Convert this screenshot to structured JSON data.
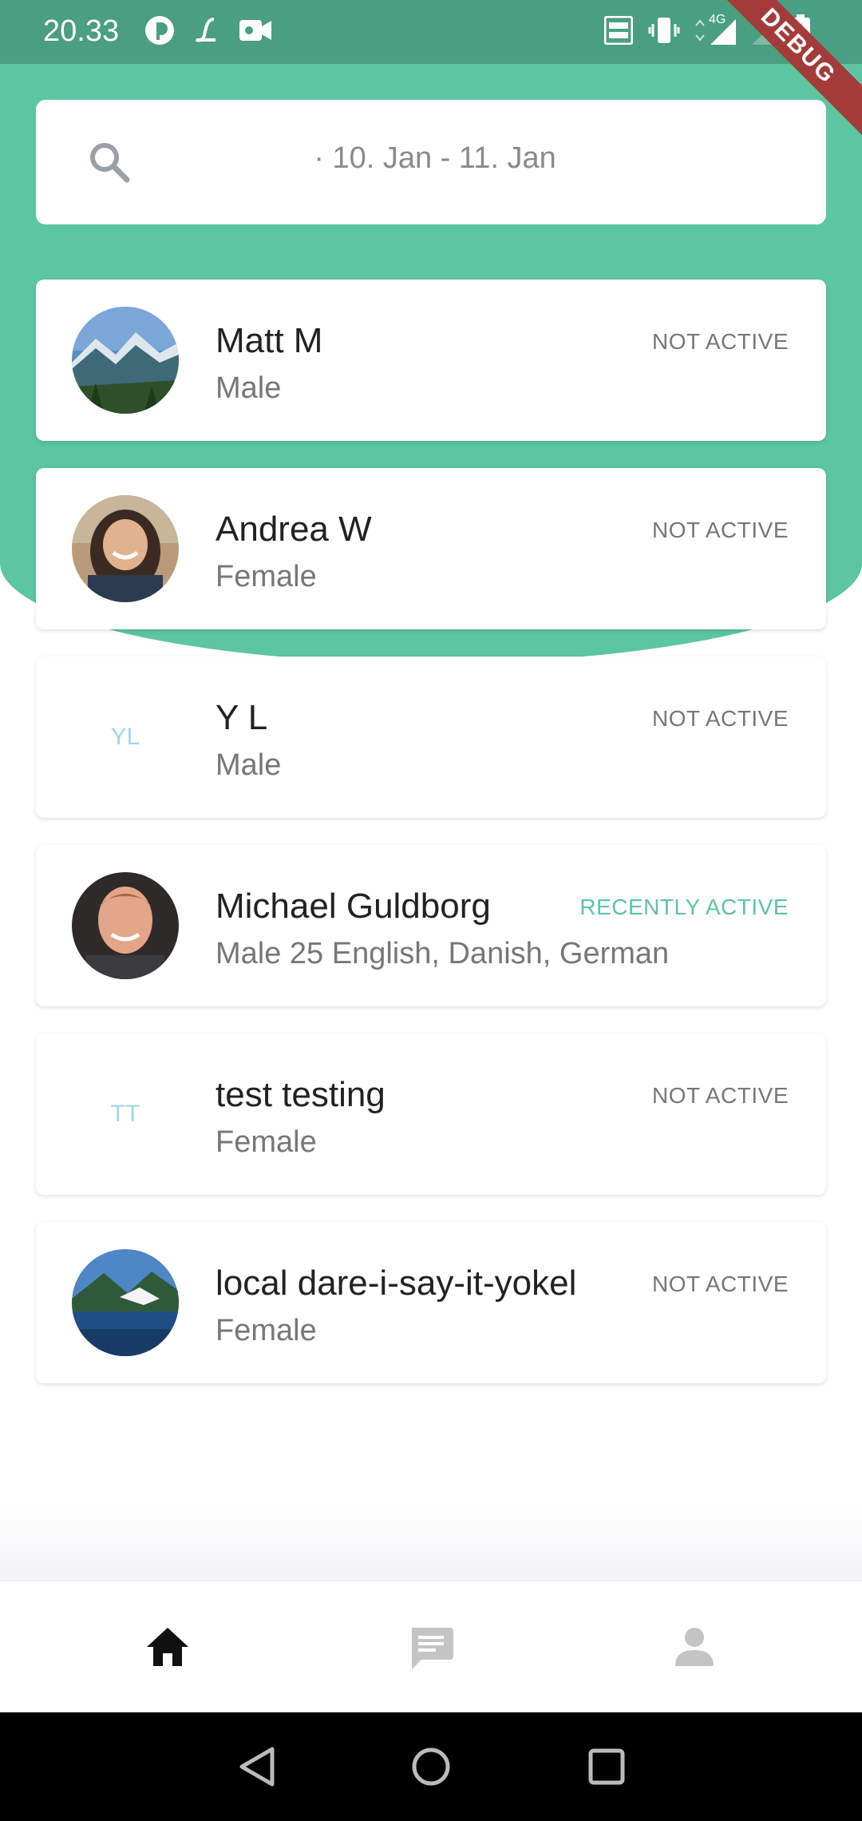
{
  "status_bar": {
    "time": "20.33",
    "debug_label": "DEBUG",
    "network_label": "4G"
  },
  "search": {
    "text": "· 10. Jan - 11. Jan"
  },
  "users": [
    {
      "name": "Matt M",
      "subtitle": "Male",
      "status": "NOT ACTIVE",
      "avatar": "mountain-landscape-photo"
    },
    {
      "name": "Andrea W",
      "subtitle": "Female",
      "status": "NOT ACTIVE",
      "avatar": "woman-portrait-photo"
    },
    {
      "name": "Y L",
      "subtitle": "Male",
      "status": "NOT ACTIVE",
      "initials": "YL"
    },
    {
      "name": "Michael Guldborg",
      "subtitle": "Male 25 English, Danish, German",
      "status": "RECENTLY ACTIVE",
      "avatar": "man-portrait-photo"
    },
    {
      "name": "test testing",
      "subtitle": "Female",
      "status": "NOT ACTIVE",
      "initials": "TT"
    },
    {
      "name": "local dare-i-say-it-yokel",
      "subtitle": "Female",
      "status": "NOT ACTIVE",
      "avatar": "lake-mountain-photo"
    }
  ],
  "bottom_nav": {
    "items": [
      "home-icon",
      "chat-icon",
      "profile-icon"
    ],
    "selected": "home-icon"
  },
  "colors": {
    "accent": "#5cc5a2",
    "status_bar": "#4a9e82",
    "initials": "#a8d3ea",
    "debug_banner": "#a33b3b"
  }
}
